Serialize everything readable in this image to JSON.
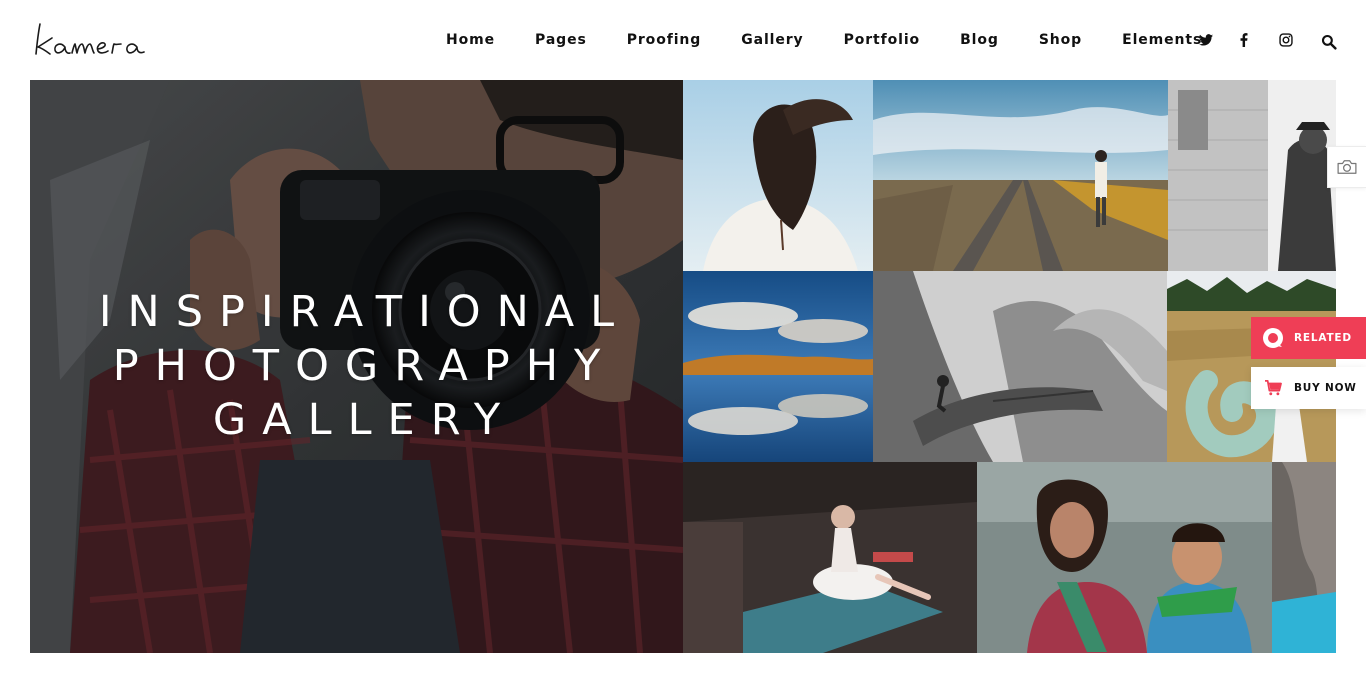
{
  "brand": {
    "logo_text": "kamera"
  },
  "nav": {
    "items": [
      {
        "label": "Home"
      },
      {
        "label": "Pages"
      },
      {
        "label": "Proofing"
      },
      {
        "label": "Gallery"
      },
      {
        "label": "Portfolio"
      },
      {
        "label": "Blog"
      },
      {
        "label": "Shop"
      },
      {
        "label": "Elements"
      }
    ],
    "social_icons": [
      "twitter-icon",
      "facebook-icon",
      "instagram-icon",
      "search-icon"
    ]
  },
  "hero": {
    "title_lines": [
      "INSPIRATIONAL",
      "PHOTOGRAPHY",
      "GALLERY"
    ]
  },
  "gallery": {
    "tiles": [
      "hero-photographer-with-camera",
      "woman-hair-in-wind",
      "man-walking-on-railway",
      "man-leaning-on-building-bw",
      "clouds-reflection-lake",
      "man-jumping-mountain-bw",
      "blue-smoke-field",
      "ballerina-sitting",
      "children-portrait",
      "partial-tile-right"
    ]
  },
  "side_widgets": {
    "related_label": "RELATED",
    "buy_now_label": "BUY NOW",
    "icons": [
      "camera-icon",
      "related-icon",
      "cart-icon"
    ]
  },
  "colors": {
    "accent": "#ef3e56",
    "text": "#111111",
    "background": "#ffffff"
  }
}
